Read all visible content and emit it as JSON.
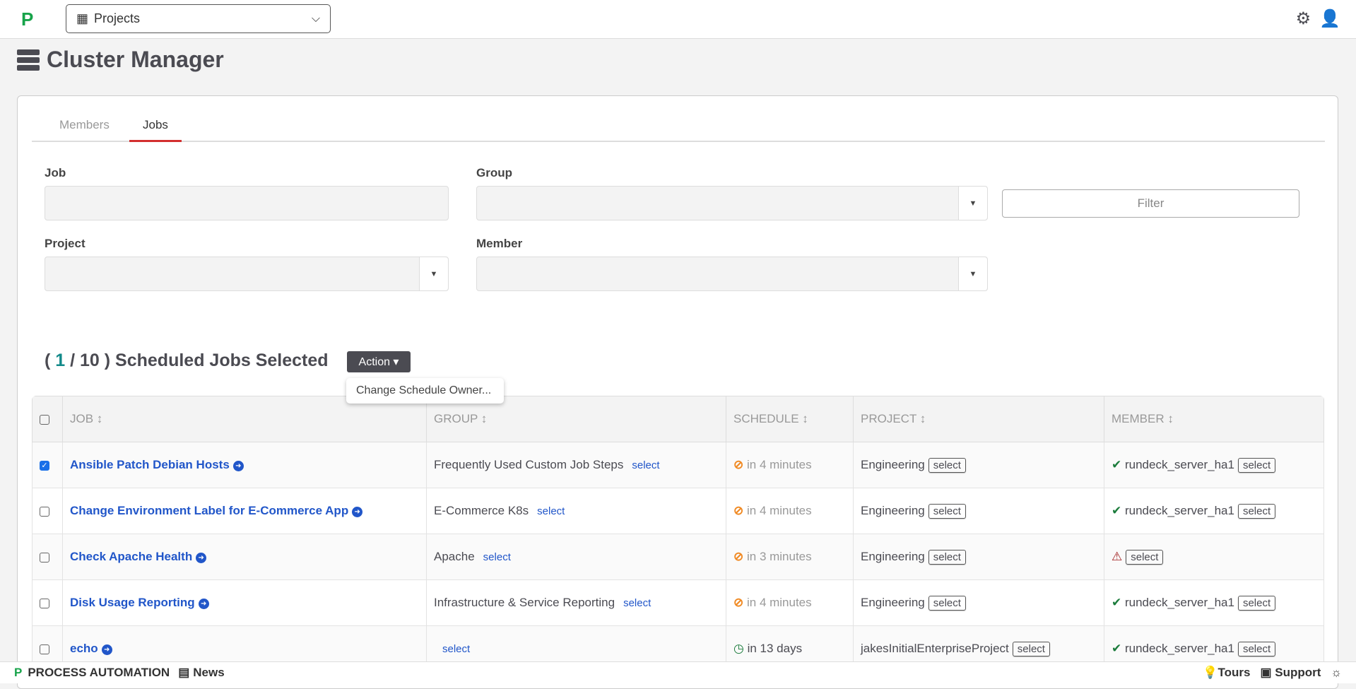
{
  "topbar": {
    "logo": "P",
    "projects": "Projects"
  },
  "page": {
    "title": "Cluster Manager"
  },
  "tabs": [
    {
      "label": "Members"
    },
    {
      "label": "Jobs"
    }
  ],
  "filters": {
    "job": "Job",
    "group": "Group",
    "project": "Project",
    "member": "Member",
    "filter_button": "Filter"
  },
  "summary": {
    "open": "( ",
    "selected": "1",
    "rest": " / 10 ) Scheduled Jobs Selected",
    "action": "Action ▾",
    "menu_item": "Change Schedule Owner..."
  },
  "table": {
    "headers": [
      "JOB ↕",
      "GROUP ↕",
      "SCHEDULE ↕",
      "PROJECT ↕",
      "MEMBER ↕"
    ],
    "select": "select",
    "rows": [
      {
        "checked": true,
        "job": "Ansible Patch Debian Hosts",
        "group": "Frequently Used Custom Job Steps",
        "schedule": "in 4 minutes",
        "schedule_status": "disabled",
        "project": "Engineering",
        "member": "rundeck_server_ha1",
        "member_status": "ok"
      },
      {
        "checked": false,
        "job": "Change Environment Label for E-Commerce App",
        "group": "E-Commerce K8s",
        "schedule": "in 4 minutes",
        "schedule_status": "disabled",
        "project": "Engineering",
        "member": "rundeck_server_ha1",
        "member_status": "ok"
      },
      {
        "checked": false,
        "job": "Check Apache Health",
        "group": "Apache",
        "schedule": "in 3 minutes",
        "schedule_status": "disabled",
        "project": "Engineering",
        "member": "",
        "member_status": "warning"
      },
      {
        "checked": false,
        "job": "Disk Usage Reporting",
        "group": "Infrastructure & Service Reporting",
        "schedule": "in 4 minutes",
        "schedule_status": "disabled",
        "project": "Engineering",
        "member": "rundeck_server_ha1",
        "member_status": "ok"
      },
      {
        "checked": false,
        "job": "echo",
        "group": "",
        "schedule": "in 13 days",
        "schedule_status": "scheduled",
        "project": "jakesInitialEnterpriseProject",
        "member": "rundeck_server_ha1",
        "member_status": "ok"
      }
    ]
  },
  "footer": {
    "brand": "PROCESS AUTOMATION",
    "news": "News",
    "tours": "Tours",
    "support": "Support"
  },
  "colors": {
    "accent": "#d32f2f",
    "link": "#2156c9",
    "brand": "#17a34a",
    "warn": "#f08a24",
    "ok": "#1c7c3c"
  }
}
